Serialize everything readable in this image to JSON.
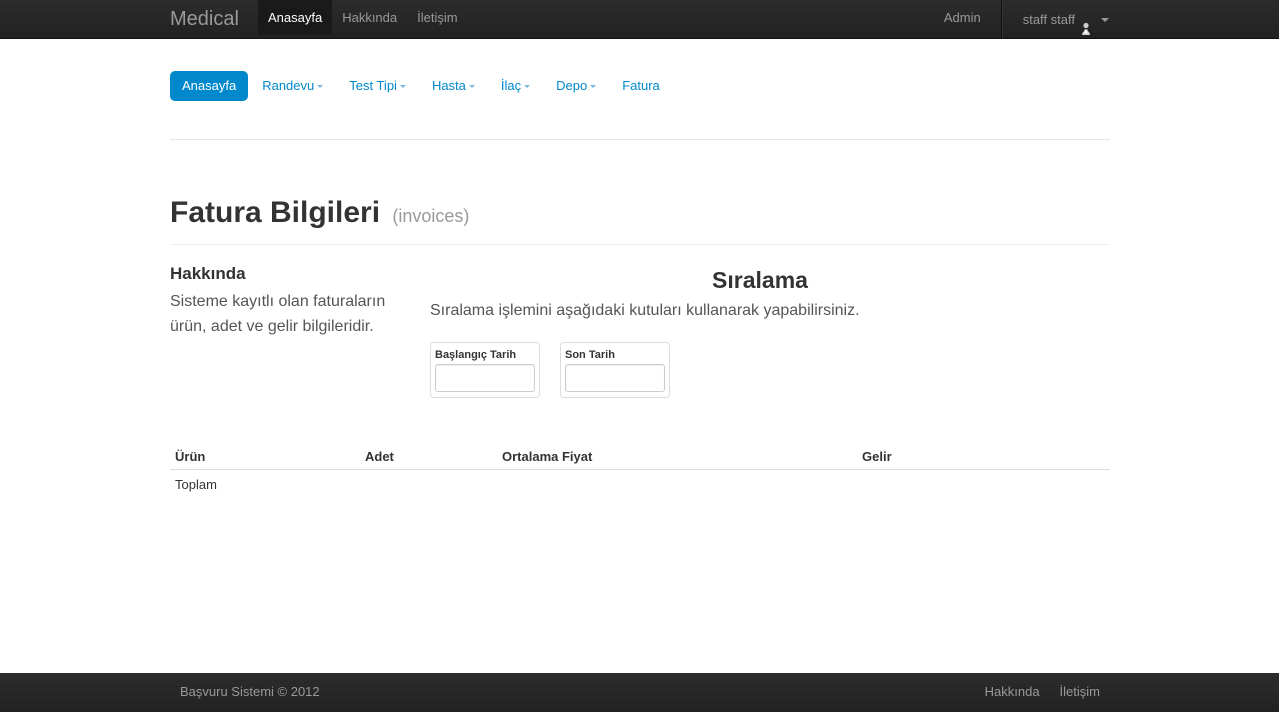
{
  "navbar": {
    "brand": "Medical",
    "links": [
      {
        "label": "Anasayfa",
        "active": true
      },
      {
        "label": "Hakkında",
        "active": false
      },
      {
        "label": "İletişim",
        "active": false
      }
    ],
    "admin_label": "Admin",
    "user_label": "staff staff"
  },
  "subnav": {
    "items": [
      {
        "label": "Anasayfa",
        "active": true,
        "dropdown": false
      },
      {
        "label": "Randevu",
        "active": false,
        "dropdown": true
      },
      {
        "label": "Test Tipi",
        "active": false,
        "dropdown": true
      },
      {
        "label": "Hasta",
        "active": false,
        "dropdown": true
      },
      {
        "label": "İlaç",
        "active": false,
        "dropdown": true
      },
      {
        "label": "Depo",
        "active": false,
        "dropdown": true
      },
      {
        "label": "Fatura",
        "active": false,
        "dropdown": false
      }
    ]
  },
  "page": {
    "title": "Fatura Bilgileri",
    "subtitle": "(invoices)"
  },
  "about": {
    "title": "Hakkında",
    "text": "Sisteme kayıtlı olan faturaların ürün, adet ve gelir bilgileridir."
  },
  "sorting": {
    "title": "Sıralama",
    "description": "Sıralama işlemini aşağıdaki kutuları kullanarak yapabilirsiniz.",
    "start_label": "Başlangıç Tarih",
    "start_value": "",
    "end_label": "Son Tarih",
    "end_value": ""
  },
  "table": {
    "headers": [
      "Ürün",
      "Adet",
      "Ortalama Fiyat",
      "Gelir"
    ],
    "rows": [
      [
        "Toplam",
        "",
        "",
        ""
      ]
    ]
  },
  "footer": {
    "copyright": "Başvuru Sistemi © 2012",
    "links": [
      "Hakkında",
      "İletişim"
    ]
  },
  "colors": {
    "accent": "#0088cc",
    "navbar_bg": "#222222"
  }
}
